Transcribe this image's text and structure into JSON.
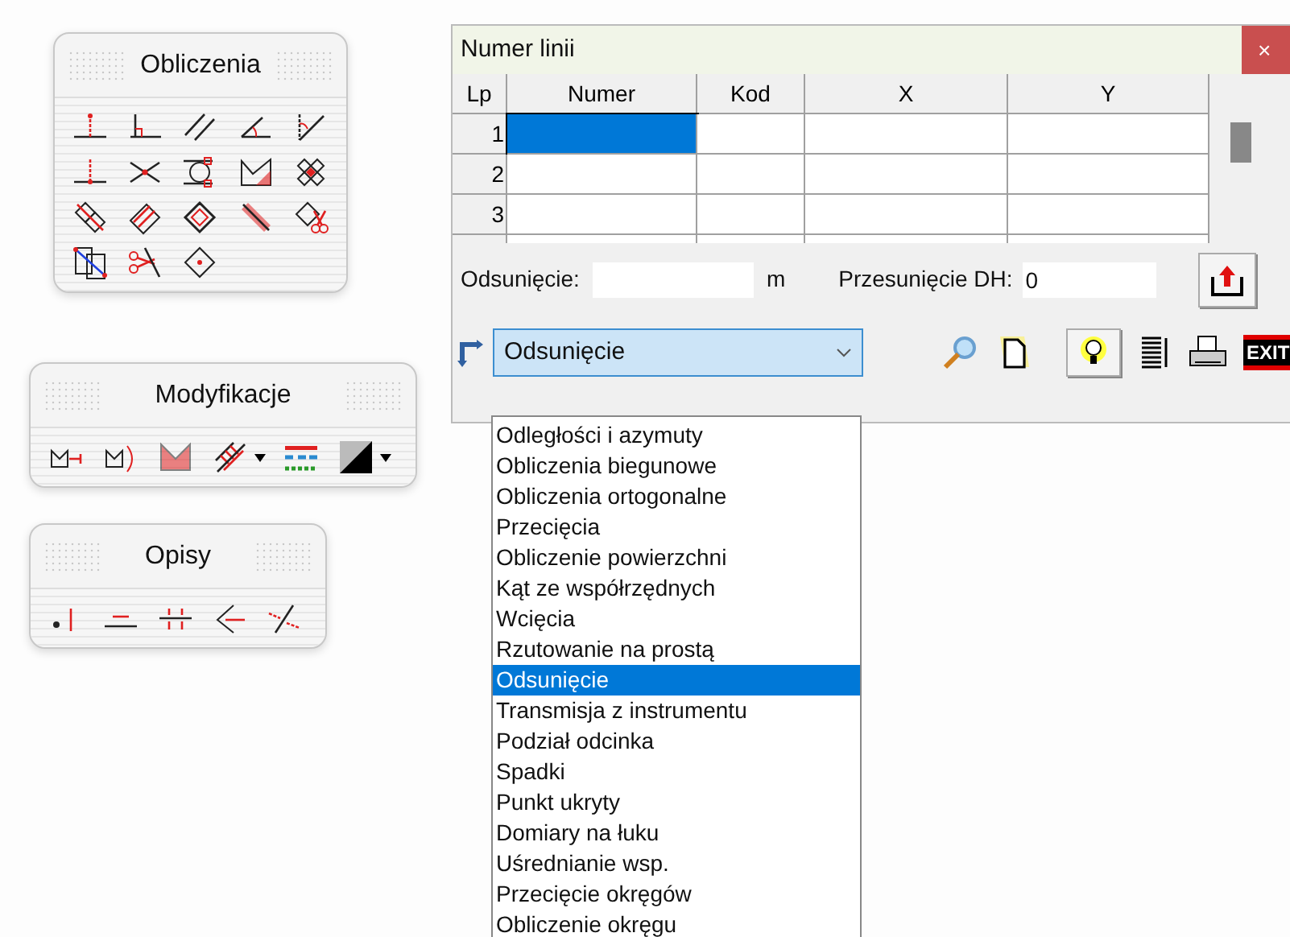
{
  "palettes": [
    {
      "title": "Obliczenia",
      "kind": "grid"
    },
    {
      "title": "Modyfikacje",
      "kind": "row"
    },
    {
      "title": "Opisy",
      "kind": "row"
    }
  ],
  "dialog": {
    "title": "Numer linii",
    "close": "×",
    "table": {
      "columns": [
        "Lp",
        "Numer",
        "Kod",
        "X",
        "Y"
      ],
      "rows": [
        {
          "lp": "1",
          "cells": [
            {
              "selected": true
            },
            {
              "selected": false
            },
            {
              "selected": false
            },
            {
              "selected": false
            }
          ]
        },
        {
          "lp": "2",
          "cells": [
            {
              "selected": false
            },
            {
              "selected": false
            },
            {
              "selected": false
            },
            {
              "selected": false
            }
          ]
        },
        {
          "lp": "3",
          "cells": [
            {
              "selected": false
            },
            {
              "selected": false
            },
            {
              "selected": false
            },
            {
              "selected": false
            }
          ]
        }
      ]
    },
    "offset": {
      "label": "Odsunięcie:",
      "unit": "m"
    },
    "shift": {
      "label": "Przesunięcie DH:",
      "value": "0"
    },
    "combo": {
      "value": "Odsunięcie"
    },
    "exit_label": "EXIT",
    "options": [
      {
        "label": "Odległości i azymuty",
        "selected": false
      },
      {
        "label": "Obliczenia biegunowe",
        "selected": false
      },
      {
        "label": "Obliczenia ortogonalne",
        "selected": false
      },
      {
        "label": "Przecięcia",
        "selected": false
      },
      {
        "label": "Obliczenie powierzchni",
        "selected": false
      },
      {
        "label": "Kąt ze współrzędnych",
        "selected": false
      },
      {
        "label": "Wcięcia",
        "selected": false
      },
      {
        "label": "Rzutowanie na prostą",
        "selected": false
      },
      {
        "label": "Odsunięcie",
        "selected": true
      },
      {
        "label": "Transmisja z instrumentu",
        "selected": false
      },
      {
        "label": "Podział odcinka",
        "selected": false
      },
      {
        "label": "Spadki",
        "selected": false
      },
      {
        "label": "Punkt ukryty",
        "selected": false
      },
      {
        "label": "Domiary na łuku",
        "selected": false
      },
      {
        "label": "Uśrednianie wsp.",
        "selected": false
      },
      {
        "label": "Przecięcie okręgów",
        "selected": false
      },
      {
        "label": "Obliczenie okręgu",
        "selected": false
      }
    ]
  }
}
